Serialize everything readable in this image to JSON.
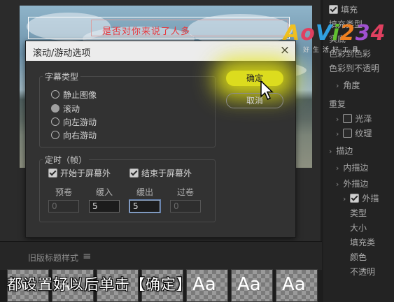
{
  "preview": {
    "title_text": "是否对你来说了人多"
  },
  "watermark": {
    "logo_parts": [
      "A",
      "o",
      "V",
      "i",
      "2",
      "3",
      "4"
    ],
    "logo_colors": [
      "#f0c020",
      "#e04060",
      "#30a0e0",
      "#60c030",
      "#f08020",
      "#a050d0",
      "#e04060"
    ],
    "sub": "好生活好工具"
  },
  "right_panel": {
    "items": [
      {
        "label": "填充",
        "checkbox": "on",
        "indent": 0
      },
      {
        "label": "填充类型",
        "checkbox": "",
        "indent": 0
      },
      {
        "label": "实底",
        "checkbox": "",
        "indent": 0
      },
      {
        "label": "色彩到色彩",
        "checkbox": "",
        "indent": 0
      },
      {
        "label": "色彩到不透明",
        "checkbox": "",
        "indent": 0
      },
      {
        "label": "角度",
        "chevron": true,
        "indent": 1
      },
      {
        "label": "重复",
        "checkbox": "",
        "indent": 0
      },
      {
        "label": "光泽",
        "checkbox": "off",
        "chevron": true,
        "indent": 1
      },
      {
        "label": "纹理",
        "checkbox": "off",
        "chevron": true,
        "indent": 1
      },
      {
        "label": "描边",
        "chevron": true,
        "indent": 0
      },
      {
        "label": "内描边",
        "chevron": true,
        "indent": 1
      },
      {
        "label": "外描边",
        "chevron": true,
        "indent": 1
      },
      {
        "label": "外描",
        "checkbox": "on",
        "chevron": true,
        "indent": 2
      },
      {
        "label": "类型",
        "indent": 3
      },
      {
        "label": "大小",
        "indent": 3
      },
      {
        "label": "填充类",
        "indent": 3
      },
      {
        "label": "颜色",
        "indent": 3
      },
      {
        "label": "不透明",
        "indent": 3
      }
    ]
  },
  "dialog": {
    "title": "滚动/游动选项",
    "close_symbol": "×",
    "caption_type": {
      "label": "字幕类型",
      "options": [
        {
          "label": "静止图像",
          "selected": false
        },
        {
          "label": "滚动",
          "selected": true
        },
        {
          "label": "向左游动",
          "selected": false
        },
        {
          "label": "向右游动",
          "selected": false
        }
      ]
    },
    "timing": {
      "label": "定时（帧）",
      "start_offscreen": "开始于屏幕外",
      "end_offscreen": "结束于屏幕外",
      "fields": [
        {
          "label": "预卷",
          "value": "0",
          "state": "disabled"
        },
        {
          "label": "缓入",
          "value": "5",
          "state": "enabled"
        },
        {
          "label": "缓出",
          "value": "5",
          "state": "focus"
        },
        {
          "label": "过卷",
          "value": "0",
          "state": "disabled"
        }
      ]
    },
    "ok_label": "确定",
    "cancel_label": "取消"
  },
  "legacy_bar": {
    "label": "旧版标题样式",
    "menu_icon": "≡"
  },
  "thumbnails": [
    "Aa",
    "Aa",
    "Aa",
    "Aa",
    "Aa",
    "Aa",
    "Aa"
  ],
  "subtitle": "都设置好以后单击【确定】"
}
